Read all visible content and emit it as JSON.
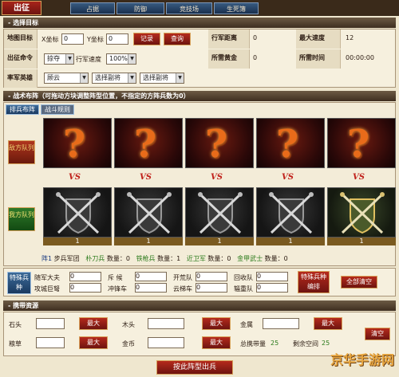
{
  "nav": {
    "active_tab": "出征",
    "tabs": [
      "占据",
      "防御",
      "竞技场",
      "生死簿"
    ]
  },
  "target_section": {
    "header": "选择目标",
    "map_target_label": "地图目标",
    "x_label": "X坐标",
    "x_value": "0",
    "y_label": "Y坐标",
    "y_value": "0",
    "record_button": "记录",
    "search_button": "查询",
    "march_distance_label": "行军距离",
    "march_distance_value": "0",
    "max_speed_label": "最大速度",
    "max_speed_value": "12",
    "order_label": "出征命令",
    "order_value": "掠夺",
    "march_speed_label": "行军速度",
    "march_speed_value": "100%",
    "gold_needed_label": "所需黄金",
    "gold_needed_value": "0",
    "time_needed_label": "所需时间",
    "time_needed_value": "00:00:00",
    "hero_label": "率军英雄",
    "hero_value": "顾云",
    "vice1_value": "选择副将",
    "vice2_value": "选择副将"
  },
  "battle_section": {
    "header": "战术布阵（可拖动方块调整阵型位置，不指定的方阵兵数为0）",
    "tab_formation": "排兵布阵",
    "tab_view": "战斗规则",
    "enemy_label": "敌方队列",
    "ally_label": "我方队列",
    "vs_text": "VS",
    "counts": [
      "1",
      "1",
      "1",
      "1",
      "1"
    ],
    "legend_prefix": "阵1",
    "legend_army": "步兵军团",
    "legend_items": [
      {
        "name": "朴刀兵",
        "label": "数量：",
        "value": "0"
      },
      {
        "name": "铁枪兵",
        "label": "数量：",
        "value": "1"
      },
      {
        "name": "近卫军",
        "label": "数量：",
        "value": "0"
      },
      {
        "name": "金甲武士",
        "label": "数量：",
        "value": "0"
      }
    ]
  },
  "special_section": {
    "special_troops_label": "特殊兵种",
    "special_compile_label": "特殊兵种编排",
    "clear_all_button": "全部清空",
    "rows": [
      [
        {
          "label": "随军大夫",
          "value": "0"
        },
        {
          "label": "斥 候",
          "value": "0"
        },
        {
          "label": "开荒队",
          "value": "0"
        },
        {
          "label": "回收队",
          "value": "0"
        }
      ],
      [
        {
          "label": "攻城巨弩",
          "value": "0"
        },
        {
          "label": "冲锋车",
          "value": "0"
        },
        {
          "label": "云梯车",
          "value": "0"
        },
        {
          "label": "辎重队",
          "value": "0"
        }
      ]
    ]
  },
  "resources_section": {
    "header": "携带资源",
    "max_label": "最大",
    "clear_button": "清空",
    "rows": [
      [
        {
          "label": "石头",
          "value": ""
        },
        {
          "label": "木头",
          "value": ""
        },
        {
          "label": "金属",
          "value": ""
        }
      ],
      [
        {
          "label": "粮草",
          "value": ""
        },
        {
          "label": "金币",
          "value": ""
        }
      ]
    ],
    "total_label": "总携带量",
    "total_value": "25",
    "remain_label": "剩余空间",
    "remain_value": "25"
  },
  "submit_button": "按此阵型出兵",
  "watermark": "京华手游网"
}
